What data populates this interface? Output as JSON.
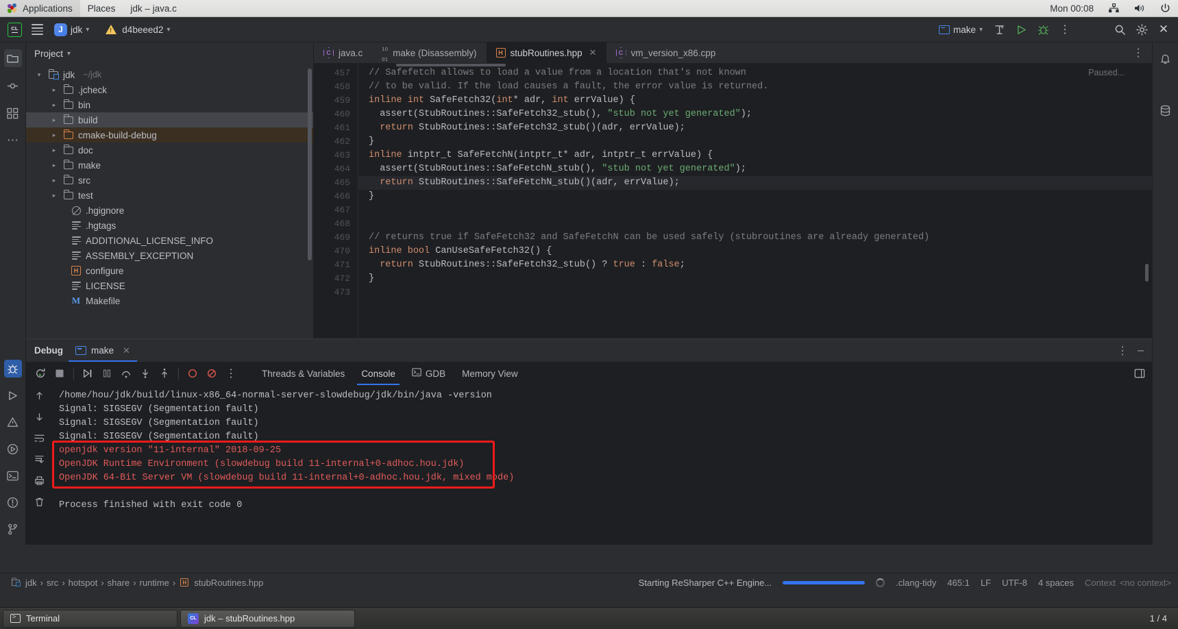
{
  "gnome": {
    "applications": "Applications",
    "places": "Places",
    "window_title": "jdk – java.c",
    "clock": "Mon 00:08",
    "icons": {
      "network": "network-icon",
      "volume": "volume-icon",
      "power": "power-icon"
    }
  },
  "toolbar": {
    "app_icon": "clion-logo-icon",
    "menu_icon": "hamburger-menu-icon",
    "project_badge": "J",
    "project_name": "jdk",
    "vcs_warning_icon": "warning-triangle-icon",
    "vcs_branch": "d4beeed2",
    "run_config": "make",
    "build_icon": "hammer-build-icon",
    "run_icon": "run-triangle-icon",
    "debug_icon": "debug-bug-icon",
    "more_icon": "more-vertical-icon",
    "search_icon": "search-icon",
    "settings_icon": "gear-icon",
    "close_icon": "close-icon"
  },
  "project": {
    "title": "Project",
    "root": {
      "name": "jdk",
      "path": "~/jdk"
    },
    "items": [
      {
        "label": ".jcheck",
        "icon": "folder-icon",
        "indent": 2,
        "arrow": true,
        "state": "normal"
      },
      {
        "label": "bin",
        "icon": "folder-icon",
        "indent": 2,
        "arrow": true,
        "state": "normal"
      },
      {
        "label": "build",
        "icon": "folder-icon",
        "indent": 2,
        "arrow": true,
        "state": "selected"
      },
      {
        "label": "cmake-build-debug",
        "icon": "folder-excluded-icon",
        "indent": 2,
        "arrow": true,
        "state": "excluded"
      },
      {
        "label": "doc",
        "icon": "folder-icon",
        "indent": 2,
        "arrow": true,
        "state": "normal"
      },
      {
        "label": "make",
        "icon": "folder-icon",
        "indent": 2,
        "arrow": true,
        "state": "normal"
      },
      {
        "label": "src",
        "icon": "folder-icon",
        "indent": 2,
        "arrow": true,
        "state": "normal"
      },
      {
        "label": "test",
        "icon": "folder-icon",
        "indent": 2,
        "arrow": true,
        "state": "normal"
      },
      {
        "label": ".hgignore",
        "icon": "ignored-file-icon",
        "indent": 3,
        "arrow": false,
        "state": "normal"
      },
      {
        "label": ".hgtags",
        "icon": "text-file-icon",
        "indent": 3,
        "arrow": false,
        "state": "normal"
      },
      {
        "label": "ADDITIONAL_LICENSE_INFO",
        "icon": "text-file-icon",
        "indent": 3,
        "arrow": false,
        "state": "normal"
      },
      {
        "label": "ASSEMBLY_EXCEPTION",
        "icon": "text-file-icon",
        "indent": 3,
        "arrow": false,
        "state": "normal"
      },
      {
        "label": "configure",
        "icon": "header-file-icon",
        "indent": 3,
        "arrow": false,
        "state": "normal"
      },
      {
        "label": "LICENSE",
        "icon": "text-file-icon",
        "indent": 3,
        "arrow": false,
        "state": "normal"
      },
      {
        "label": "Makefile",
        "icon": "makefile-icon",
        "indent": 3,
        "arrow": false,
        "state": "normal"
      }
    ]
  },
  "editor": {
    "tabs": [
      {
        "label": "java.c",
        "icon": "c-file-icon",
        "active": false,
        "closable": false
      },
      {
        "label": "make (Disassembly)",
        "icon": "disassembly-icon",
        "active": false,
        "closable": false
      },
      {
        "label": "stubRoutines.hpp",
        "icon": "header-file-icon",
        "active": true,
        "closable": true
      },
      {
        "label": "vm_version_x86.cpp",
        "icon": "cpp-file-icon",
        "active": false,
        "closable": false
      }
    ],
    "paused_label": "Paused...",
    "more_icon": "more-vertical-icon",
    "first_line_number": 457,
    "current_line": 465,
    "lines": [
      {
        "n": 457,
        "tokens": [
          {
            "t": "// Safefetch allows to load a value from a location that's not known",
            "c": "com"
          }
        ]
      },
      {
        "n": 458,
        "tokens": [
          {
            "t": "// to be valid. If the load causes a fault, the error value is returned.",
            "c": "com"
          }
        ]
      },
      {
        "n": 459,
        "tokens": [
          {
            "t": "inline",
            "c": "kw"
          },
          {
            "t": " ",
            "c": "txt"
          },
          {
            "t": "int",
            "c": "kw"
          },
          {
            "t": " SafeFetch32(",
            "c": "txt"
          },
          {
            "t": "int",
            "c": "kw"
          },
          {
            "t": "* adr, ",
            "c": "txt"
          },
          {
            "t": "int",
            "c": "kw"
          },
          {
            "t": " errValue) {",
            "c": "txt"
          }
        ]
      },
      {
        "n": 460,
        "tokens": [
          {
            "t": "  assert(StubRoutines::SafeFetch32_stub(), ",
            "c": "txt"
          },
          {
            "t": "\"stub not yet generated\"",
            "c": "str"
          },
          {
            "t": ");",
            "c": "txt"
          }
        ]
      },
      {
        "n": 461,
        "tokens": [
          {
            "t": "  ",
            "c": "txt"
          },
          {
            "t": "return",
            "c": "kw"
          },
          {
            "t": " StubRoutines::SafeFetch32_stub()(adr, errValue);",
            "c": "txt"
          }
        ]
      },
      {
        "n": 462,
        "tokens": [
          {
            "t": "}",
            "c": "txt"
          }
        ]
      },
      {
        "n": 463,
        "tokens": [
          {
            "t": "inline",
            "c": "kw"
          },
          {
            "t": " intptr_t SafeFetchN(intptr_t* adr, intptr_t errValue) {",
            "c": "txt"
          }
        ]
      },
      {
        "n": 464,
        "tokens": [
          {
            "t": "  assert(StubRoutines::SafeFetchN_stub(), ",
            "c": "txt"
          },
          {
            "t": "\"stub not yet generated\"",
            "c": "str"
          },
          {
            "t": ");",
            "c": "txt"
          }
        ]
      },
      {
        "n": 465,
        "tokens": [
          {
            "t": "  ",
            "c": "txt"
          },
          {
            "t": "return",
            "c": "kw"
          },
          {
            "t": " StubRoutines::SafeFetchN_stub()(adr, errValue);",
            "c": "txt"
          }
        ]
      },
      {
        "n": 466,
        "tokens": [
          {
            "t": "}",
            "c": "txt"
          }
        ]
      },
      {
        "n": 467,
        "tokens": []
      },
      {
        "n": 468,
        "tokens": []
      },
      {
        "n": 469,
        "tokens": [
          {
            "t": "// returns true if SafeFetch32 and SafeFetchN can be used safely (stubroutines are already generated)",
            "c": "com"
          }
        ]
      },
      {
        "n": 470,
        "tokens": [
          {
            "t": "inline",
            "c": "kw"
          },
          {
            "t": " ",
            "c": "txt"
          },
          {
            "t": "bool",
            "c": "kw"
          },
          {
            "t": " CanUseSafeFetch32() {",
            "c": "txt"
          }
        ]
      },
      {
        "n": 471,
        "tokens": [
          {
            "t": "  ",
            "c": "txt"
          },
          {
            "t": "return",
            "c": "kw"
          },
          {
            "t": " StubRoutines::SafeFetch32_stub() ? ",
            "c": "txt"
          },
          {
            "t": "true",
            "c": "kw"
          },
          {
            "t": " : ",
            "c": "txt"
          },
          {
            "t": "false",
            "c": "kw"
          },
          {
            "t": ";",
            "c": "txt"
          }
        ]
      },
      {
        "n": 472,
        "tokens": [
          {
            "t": "}",
            "c": "txt"
          }
        ]
      },
      {
        "n": 473,
        "tokens": []
      }
    ]
  },
  "debug": {
    "title": "Debug",
    "session_tab": "make",
    "session_icon": "run-config-icon",
    "session_close_icon": "close-icon",
    "options_icon": "more-vertical-icon",
    "minimize_icon": "minimize-icon",
    "toolbar_icons": [
      "rerun-icon",
      "stop-icon",
      "resume-icon",
      "pause-icon",
      "step-over-icon",
      "step-into-icon",
      "step-out-icon",
      "view-breakpoints-icon",
      "mute-breakpoints-icon",
      "more-vertical-icon"
    ],
    "tabs": [
      {
        "label": "Threads & Variables",
        "active": false,
        "icon": null
      },
      {
        "label": "Console",
        "active": true,
        "icon": null
      },
      {
        "label": "GDB",
        "active": false,
        "icon": "gdb-console-icon"
      },
      {
        "label": "Memory View",
        "active": false,
        "icon": null
      }
    ],
    "console_rail_icons": [
      "scroll-up-icon",
      "scroll-down-icon",
      "soft-wrap-icon",
      "scroll-to-end-icon",
      "print-icon",
      "clear-all-icon"
    ],
    "layout_icon": "layout-settings-icon",
    "console_lines": [
      {
        "text": "/home/hou/jdk/build/linux-x86_64-normal-server-slowdebug/jdk/bin/java -version",
        "color": "normal"
      },
      {
        "text": "Signal: SIGSEGV (Segmentation fault)",
        "color": "normal"
      },
      {
        "text": "Signal: SIGSEGV (Segmentation fault)",
        "color": "normal"
      },
      {
        "text": "Signal: SIGSEGV (Segmentation fault)",
        "color": "normal"
      },
      {
        "text": "openjdk version \"11-internal\" 2018-09-25",
        "color": "red"
      },
      {
        "text": "OpenJDK Runtime Environment (slowdebug build 11-internal+0-adhoc.hou.jdk)",
        "color": "red"
      },
      {
        "text": "OpenJDK 64-Bit Server VM (slowdebug build 11-internal+0-adhoc.hou.jdk, mixed mode)",
        "color": "red"
      },
      {
        "text": "",
        "color": "normal"
      },
      {
        "text": "Process finished with exit code 0",
        "color": "normal"
      }
    ],
    "highlight_color": "#f01b1b"
  },
  "status_bar": {
    "breadcrumbs": [
      {
        "label": "jdk",
        "icon": "module-icon"
      },
      {
        "label": "src",
        "icon": null
      },
      {
        "label": "hotspot",
        "icon": null
      },
      {
        "label": "share",
        "icon": null
      },
      {
        "label": "runtime",
        "icon": null
      },
      {
        "label": "stubRoutines.hpp",
        "icon": "header-file-icon"
      }
    ],
    "progress_text": "Starting ReSharper C++ Engine...",
    "progress_percent": 100,
    "inspection_profile": ".clang-tidy",
    "caret_position": "465:1",
    "line_separator": "LF",
    "encoding": "UTF-8",
    "indent": "4 spaces",
    "context_label": "Context",
    "context_value": "<no context>"
  },
  "taskbar": {
    "items": [
      {
        "label": "Terminal",
        "icon": "terminal-icon",
        "active": false
      },
      {
        "label": "jdk – stubRoutines.hpp",
        "icon": "clion-icon",
        "active": true
      }
    ],
    "workspace": "1 / 4"
  },
  "rails": {
    "left_icons": [
      "project-folder-icon",
      "commit-icon",
      "structure-icon",
      "more-tools-icon",
      "debug-icon",
      "run-icon",
      "problems-icon",
      "services-icon",
      "terminal-icon",
      "notifications-icon",
      "vcs-branch-icon"
    ],
    "right_icons": [
      "notifications-bell-icon",
      "database-icon"
    ]
  }
}
